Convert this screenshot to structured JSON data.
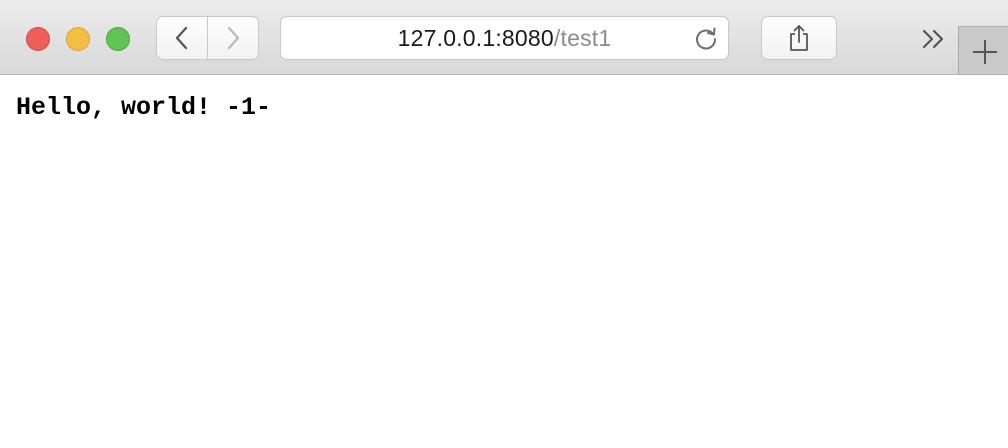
{
  "colors": {
    "close": "#ee5f5b",
    "minimize": "#f6bd43",
    "zoom": "#61c454",
    "toolbar": "#dedede"
  },
  "toolbar": {
    "back_icon": "chevron-left-icon",
    "forward_icon": "chevron-right-icon",
    "reload_icon": "reload-icon",
    "share_icon": "share-icon",
    "overflow_icon": "double-chevron-right-icon",
    "new_tab_icon": "plus-icon"
  },
  "address": {
    "host": "127.0.0.1:8080",
    "path": "/test1"
  },
  "page": {
    "text": "Hello, world! -1-"
  }
}
